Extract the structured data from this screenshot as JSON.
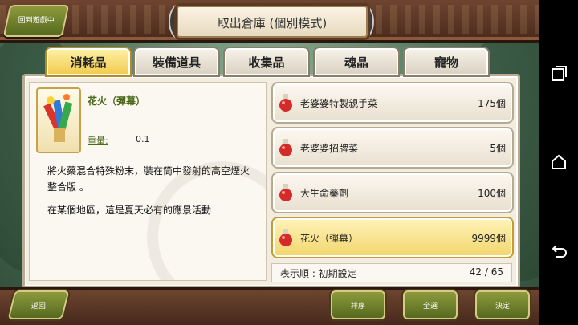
{
  "header": {
    "back_to_game": "回到遊戲中",
    "title": "取出倉庫 (個別模式)"
  },
  "tabs": [
    {
      "label": "消耗品",
      "active": true
    },
    {
      "label": "裝備道具",
      "active": false
    },
    {
      "label": "收集品",
      "active": false
    },
    {
      "label": "魂晶",
      "active": false
    },
    {
      "label": "寵物",
      "active": false
    }
  ],
  "detail": {
    "name": "花火（彈幕）",
    "weight_label": "重量:",
    "weight_value": "0.1",
    "description": "將火藥混合特殊粉末，裝在筒中發射的高空煙火整合版 。",
    "description2": "在某個地區，這是夏天必有的應景活動"
  },
  "items": [
    {
      "name": "老婆婆特製親手菜",
      "count": "175個",
      "selected": false
    },
    {
      "name": "老婆婆招牌菜",
      "count": "5個",
      "selected": false
    },
    {
      "name": "大生命藥劑",
      "count": "100個",
      "selected": false
    },
    {
      "name": "花火（彈幕）",
      "count": "9999個",
      "selected": true
    }
  ],
  "list_footer": {
    "sort": "表示順 : 初期設定",
    "count": "42 / 65"
  },
  "buttons": {
    "back": "返回",
    "sort": "排序",
    "select_all": "全選",
    "confirm": "決定"
  },
  "colors": {
    "accent_green": "#556a1f",
    "tab_active": "#f0c94a",
    "wood": "#6e4530"
  }
}
